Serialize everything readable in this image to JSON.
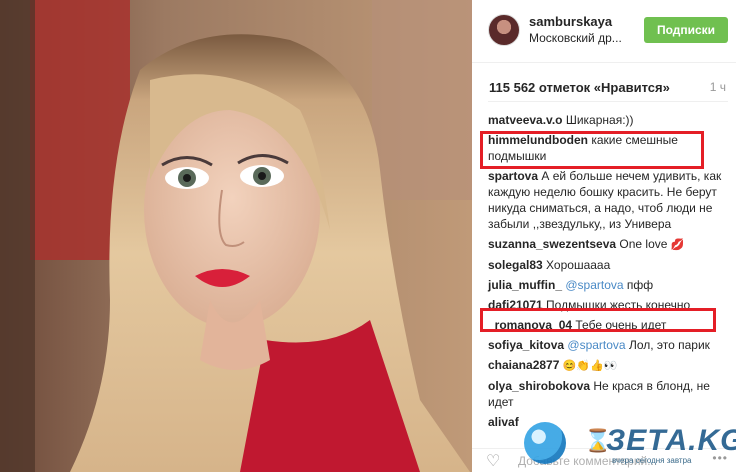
{
  "post": {
    "username": "samburskaya",
    "location": "Московский др...",
    "follow_label": "Подписки",
    "likes": "115 562 отметок «Нравится»",
    "age": "1 ч"
  },
  "comments": [
    {
      "user": "matveeva.v.o",
      "text": "Шикарная:))"
    },
    {
      "user": "himmelundboden",
      "text": "какие смешные подмышки",
      "highlighted": true
    },
    {
      "user": "spartova",
      "text": "А ей больше нечем удивить, как каждую неделю бошку красить. Не берут никуда сниматься, а надо, чтоб люди не забыли ,,звездульку,, из Универа"
    },
    {
      "user": "suzanna_swezentseva",
      "text": "One love",
      "emoji": "💋"
    },
    {
      "user": "solegal83",
      "text": "Хорошаааа"
    },
    {
      "user": "julia_muffin_",
      "mention": "@spartova",
      "text": "пфф"
    },
    {
      "user": "dafi21071",
      "text": "Подмышки жесть конечно",
      "highlighted": true
    },
    {
      "user": "_romanova_04",
      "text": "Тебе очень идет"
    },
    {
      "user": "sofiya_kitova",
      "mention": "@spartova",
      "text": "Лол, это парик"
    },
    {
      "user": "chaiana2877",
      "text": "",
      "emoji": "😊👏👍👀"
    },
    {
      "user": "olya_shirobokova",
      "text": "Не крася в блонд, не идет"
    },
    {
      "user": "alivaf",
      "text": ""
    }
  ],
  "footer": {
    "add_comment_placeholder": "Добавьте комментарий...",
    "heart_icon": "heart-outline-icon",
    "more_icon": "more-dots-icon"
  },
  "watermark": {
    "brand": "ЗЕТА.KG",
    "tagline": "вчера сегодня завтра"
  },
  "colors": {
    "follow_button": "#70c050",
    "highlight_box": "#e41e26",
    "mention": "#4a8ac6"
  }
}
